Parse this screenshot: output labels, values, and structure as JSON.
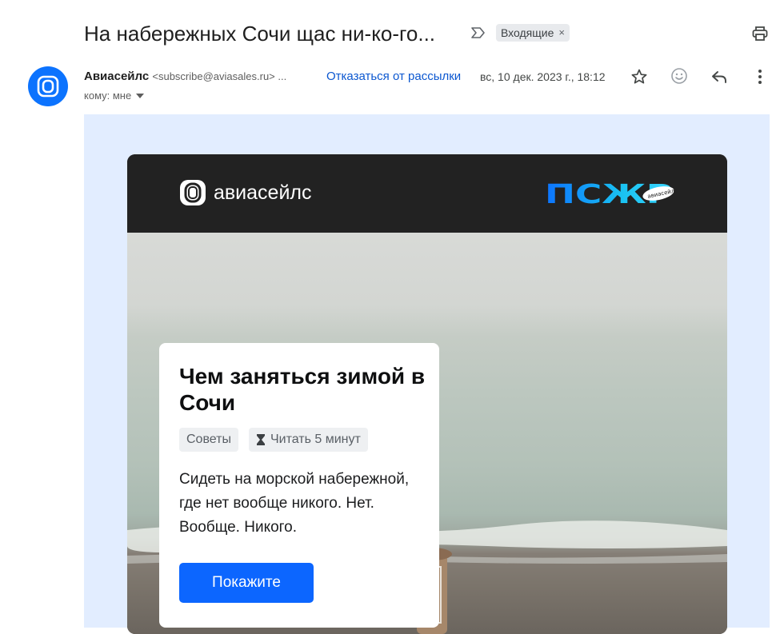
{
  "header": {
    "subject": "На набережных Сочи щас ни-ко-го...",
    "label": "Входящие",
    "label_remove": "×"
  },
  "sender": {
    "name": "Авиасейлс",
    "email": "<subscribe@aviasales.ru> ...",
    "unsubscribe": "Отказаться от рассылки",
    "date": "вс, 10 дек. 2023 г., 18:12",
    "to": "кому: мне"
  },
  "email": {
    "brand_name": "авиасейлс",
    "campaign_logo": "ПСЖР",
    "campaign_logo_badge": "авиасейлс",
    "card": {
      "title": "Чем заняться зимой в Сочи",
      "tag_category": "Советы",
      "tag_read_time": "Читать 5 минут",
      "text": "Сидеть на морской набережной, где нет вообще никого. Нет. Вообще. Никого.",
      "cta": "Покажите"
    }
  },
  "colors": {
    "accent": "#0b57d0",
    "brand_blue": "#0c66ff",
    "email_background": "#e2edff",
    "header_dark": "#222222"
  },
  "icons": {
    "importance": "importance-marker-icon",
    "print": "print-icon",
    "star": "star-icon",
    "emoji": "emoji-reaction-icon",
    "reply": "reply-icon",
    "more": "more-vert-icon",
    "dropdown": "caret-down-icon",
    "hourglass": "hourglass-icon"
  }
}
